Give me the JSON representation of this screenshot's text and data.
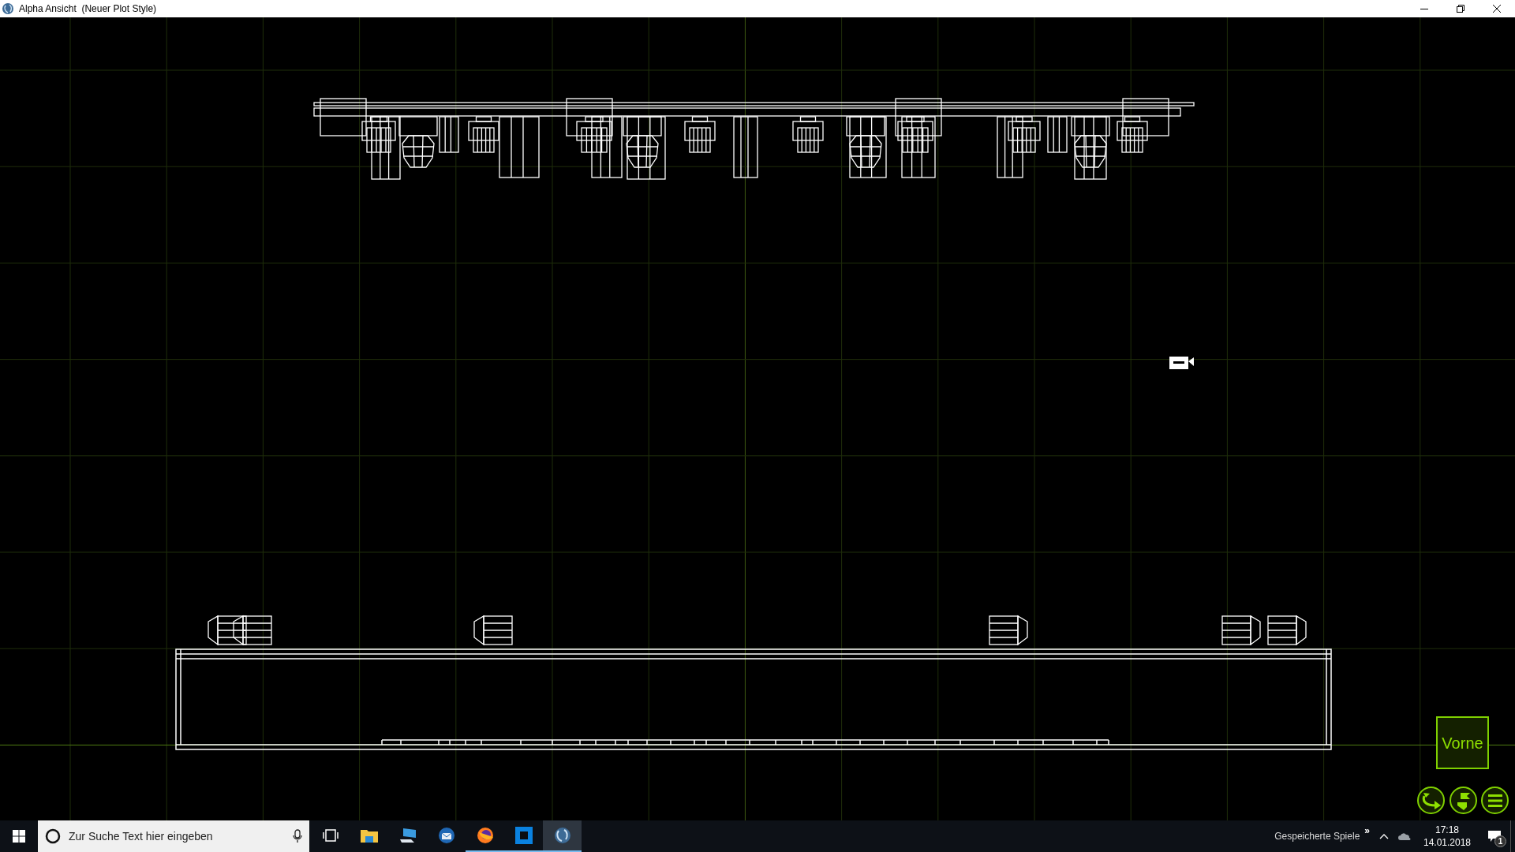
{
  "window": {
    "title": "Alpha Ansicht  (Neuer Plot Style)"
  },
  "viewport": {
    "view_label": "Vorne"
  },
  "taskbar": {
    "search": {
      "placeholder": "Zur Suche Text hier eingeben"
    },
    "apps": [
      {
        "kind": "task-view",
        "running": false,
        "selected": false
      },
      {
        "kind": "folder",
        "running": false,
        "selected": false
      },
      {
        "kind": "computer",
        "running": false,
        "selected": false
      },
      {
        "kind": "mail",
        "running": false,
        "selected": false
      },
      {
        "kind": "browser",
        "running": true,
        "selected": false
      },
      {
        "kind": "square",
        "running": true,
        "selected": false
      },
      {
        "kind": "globe",
        "running": true,
        "selected": true
      }
    ],
    "tray": {
      "toolbar_label": "Gespeicherte Spiele",
      "toolbar_chevron": "»",
      "time": "17:18",
      "date": "14.01.2018",
      "notification_count": "1"
    }
  }
}
